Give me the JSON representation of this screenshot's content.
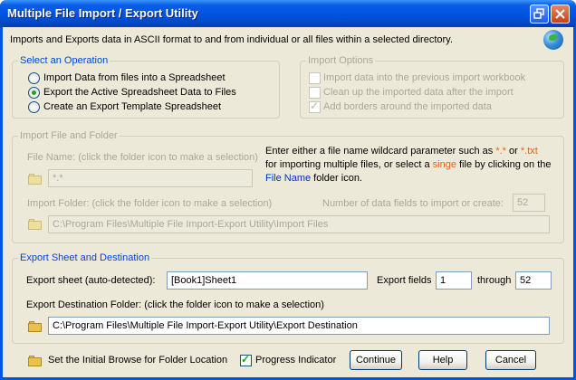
{
  "window": {
    "title": "Multiple File Import / Export Utility"
  },
  "description": "Imports and Exports data in ASCII format to and from individual or all files within a selected directory.",
  "select_operation": {
    "legend": "Select an Operation",
    "options": [
      {
        "label": "Import Data from files into a Spreadsheet",
        "selected": false
      },
      {
        "label": "Export the Active Spreadsheet Data to Files",
        "selected": true
      },
      {
        "label": "Create an Export Template Spreadsheet",
        "selected": false
      }
    ]
  },
  "import_options": {
    "legend": "Import Options",
    "options": [
      {
        "label": "Import data into the previous import workbook",
        "checked": false
      },
      {
        "label": "Clean up the imported data after the import",
        "checked": false
      },
      {
        "label": "Add borders around the imported data",
        "checked": true
      }
    ]
  },
  "import_file": {
    "legend": "Import File and Folder",
    "file_name_label": "File Name: (click the folder icon to make a selection)",
    "file_name_value": "*.*",
    "help_1": "Enter either a file name wildcard parameter such as ",
    "help_star": "*.*",
    "help_or": " or ",
    "help_txt": "*.txt",
    "help_2": "for importing multiple files, or select a ",
    "help_singe": "singe",
    "help_3": " file by clicking on the",
    "help_filename": "File Name",
    "help_4": " folder icon.",
    "folder_label": "Import Folder: (click the folder icon to make a selection)",
    "fields_label": "Number of data fields to import or create:",
    "fields_value": "52",
    "folder_value": "C:\\Program Files\\Multiple File Import-Export Utility\\Import Files"
  },
  "export": {
    "legend": "Export Sheet and Destination",
    "sheet_label": "Export sheet (auto-detected):",
    "sheet_value": "[Book1]Sheet1",
    "fields_label": "Export fields",
    "fields_from": "1",
    "through_label": "through",
    "fields_to": "52",
    "dest_label": "Export Destination Folder: (click the folder icon to make a selection)",
    "dest_value": "C:\\Program Files\\Multiple File Import-Export Utility\\Export Destination"
  },
  "footer": {
    "browse_label": "Set the Initial Browse for Folder Location",
    "progress_label": "Progress Indicator",
    "progress_checked": true,
    "continue_label": "Continue",
    "help_label": "Help",
    "cancel_label": "Cancel"
  }
}
